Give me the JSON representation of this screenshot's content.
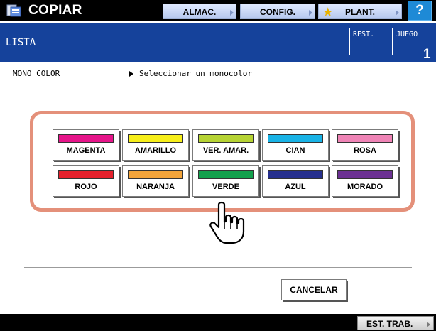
{
  "app": {
    "title": "COPIAR",
    "icon": "copier-icon"
  },
  "toolbar": {
    "almac_label": "ALMAC.",
    "config_label": "CONFIG.",
    "plant_label": "PLANT.",
    "help_label": "?"
  },
  "header": {
    "title": "LISTA",
    "rest_label": "REST.",
    "juego_label": "JUEGO",
    "juego_value": "1"
  },
  "mode": {
    "label": "MONO COLOR",
    "value": "Seleccionar un monocolor"
  },
  "colors": [
    {
      "label": "MAGENTA",
      "swatch": "#e6158a"
    },
    {
      "label": "AMARILLO",
      "swatch": "#f7ef1a"
    },
    {
      "label": "VER. AMAR.",
      "swatch": "#b6d334"
    },
    {
      "label": "CIAN",
      "swatch": "#19b3e6"
    },
    {
      "label": "ROSA",
      "swatch": "#ef84b6"
    },
    {
      "label": "ROJO",
      "swatch": "#e4202c"
    },
    {
      "label": "NARANJA",
      "swatch": "#f3a43a"
    },
    {
      "label": "VERDE",
      "swatch": "#12a04c"
    },
    {
      "label": "AZUL",
      "swatch": "#262f8d"
    },
    {
      "label": "MORADO",
      "swatch": "#6b3092"
    }
  ],
  "actions": {
    "cancel_label": "CANCELAR"
  },
  "footer": {
    "job_status_label": "EST. TRAB."
  },
  "theme": {
    "header_blue": "#15429b",
    "frame_accent": "#e4907a",
    "help_blue": "#1e8ad6"
  }
}
